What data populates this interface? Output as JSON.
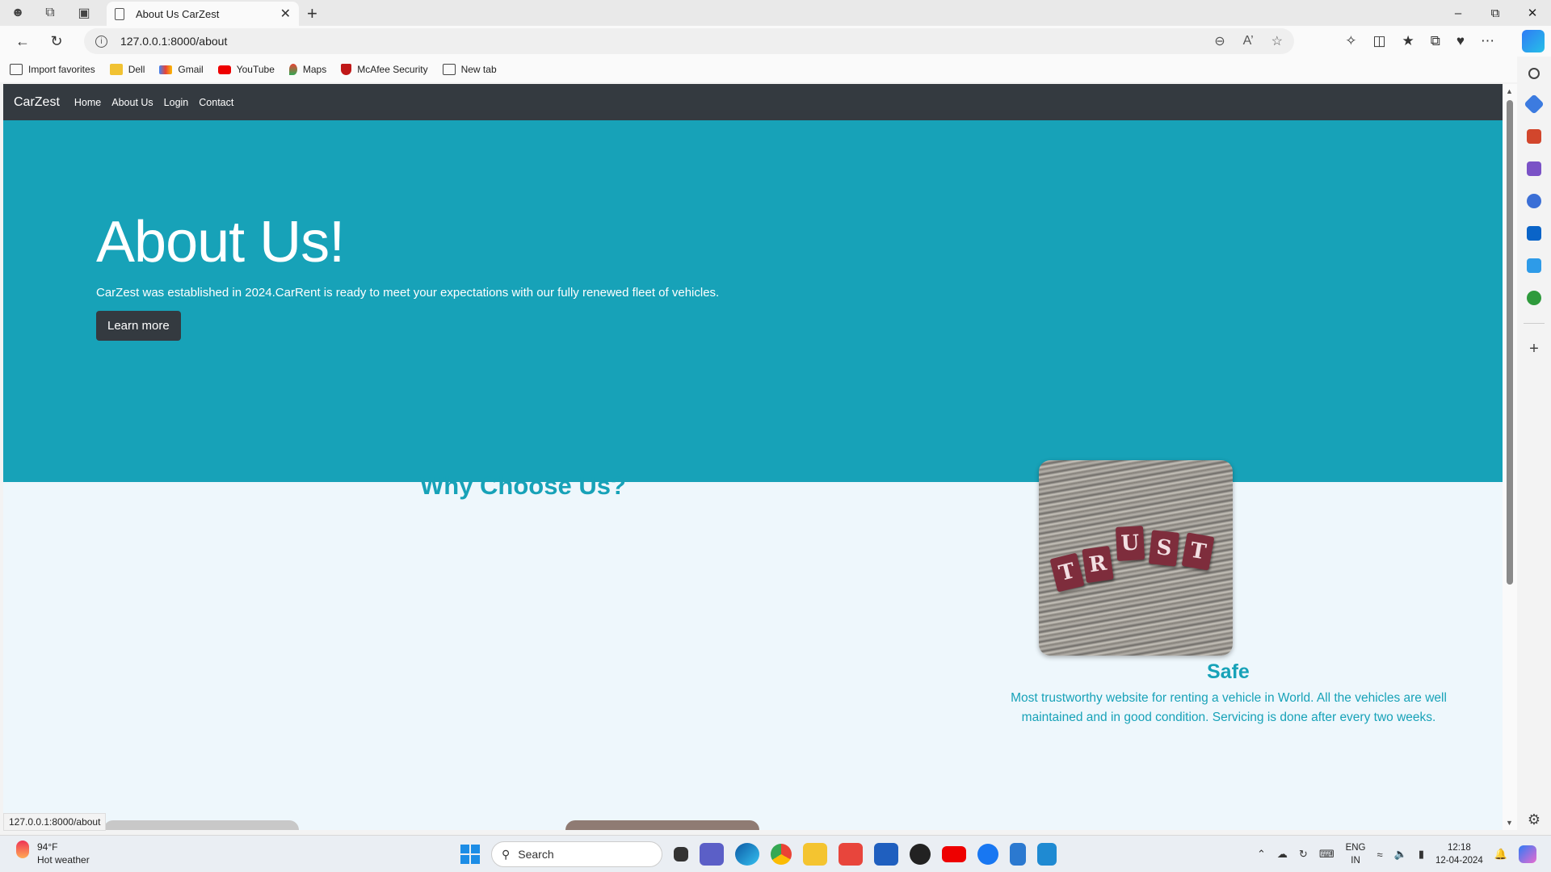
{
  "browser": {
    "tab_title": "About Us CarZest",
    "url": "127.0.0.1:8000/about",
    "status_url": "127.0.0.1:8000/about"
  },
  "bookmarks": [
    {
      "label": "Import favorites",
      "icon": "import-icon"
    },
    {
      "label": "Dell",
      "icon": "folder-icon"
    },
    {
      "label": "Gmail",
      "icon": "gmail-icon"
    },
    {
      "label": "YouTube",
      "icon": "youtube-icon"
    },
    {
      "label": "Maps",
      "icon": "maps-icon"
    },
    {
      "label": "McAfee Security",
      "icon": "mcafee-icon"
    },
    {
      "label": "New tab",
      "icon": "newtab-icon"
    }
  ],
  "site": {
    "brand": "CarZest",
    "nav": [
      "Home",
      "About Us",
      "Login",
      "Contact"
    ],
    "hero": {
      "title": "About Us!",
      "text": "CarZest was established in 2024.CarRent is ready to meet your expectations with our fully renewed fleet of vehicles.",
      "button": "Learn more"
    },
    "why_title": "Why Choose Us?",
    "feature": {
      "image_letters": [
        "T",
        "R",
        "U",
        "S",
        "T"
      ],
      "title": "Safe",
      "text": "Most trustworthy website for renting a vehicle in World. All the vehicles are well maintained and in good condition. Servicing is done after every two weeks."
    }
  },
  "colors": {
    "primary": "#17a2b8",
    "navbar": "#343a40",
    "page_bg": "#eef7fc"
  },
  "taskbar": {
    "weather_temp": "94°F",
    "weather_desc": "Hot weather",
    "search_placeholder": "Search",
    "lang_line1": "ENG",
    "lang_line2": "IN",
    "time": "12:18",
    "date": "12-04-2024"
  }
}
